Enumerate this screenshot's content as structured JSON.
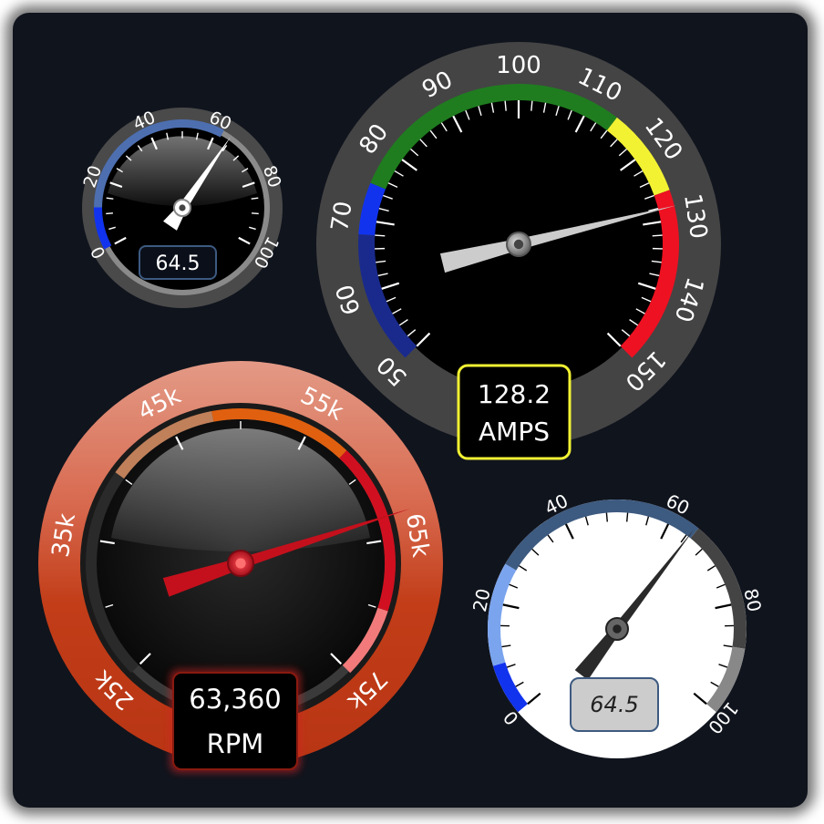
{
  "gauges": {
    "small_dark": {
      "ticks": [
        "0",
        "20",
        "40",
        "60",
        "80",
        "100"
      ],
      "value": 64.5,
      "readout": "64.5",
      "colors": {
        "bezel": "#4a4a4a",
        "range_low": "#1133ee",
        "range_mid": "#4d6fb0",
        "needle": "#ffffff"
      }
    },
    "amps": {
      "ticks": [
        "50",
        "60",
        "70",
        "80",
        "90",
        "100",
        "110",
        "120",
        "130",
        "140",
        "150"
      ],
      "value": 128.2,
      "readout_value": "128.2",
      "readout_unit": "AMPS",
      "colors": {
        "dark_blue": "#1a2a8c",
        "blue": "#1133ee",
        "green": "#1f7d1f",
        "yellow": "#f2f233",
        "red": "#ee1122",
        "readout_border": "#f2f233"
      }
    },
    "rpm": {
      "ticks": [
        "25k",
        "35k",
        "45k",
        "55k",
        "65k",
        "75k"
      ],
      "value": 63360,
      "readout_value": "63,360",
      "readout_unit": "RPM",
      "colors": {
        "bezel": "#c8401a",
        "needle": "#c4101c",
        "range_orange": "#e06010",
        "range_red": "#d01020"
      }
    },
    "light": {
      "ticks": [
        "0",
        "20",
        "40",
        "60",
        "80",
        "100"
      ],
      "value": 64.5,
      "readout": "64.5",
      "colors": {
        "face": "#ffffff",
        "blue_low": "#1133ee",
        "blue_mid": "#7aa4ee",
        "steel": "#3d5a80",
        "grey": "#444444",
        "light_grey": "#888888"
      }
    }
  }
}
